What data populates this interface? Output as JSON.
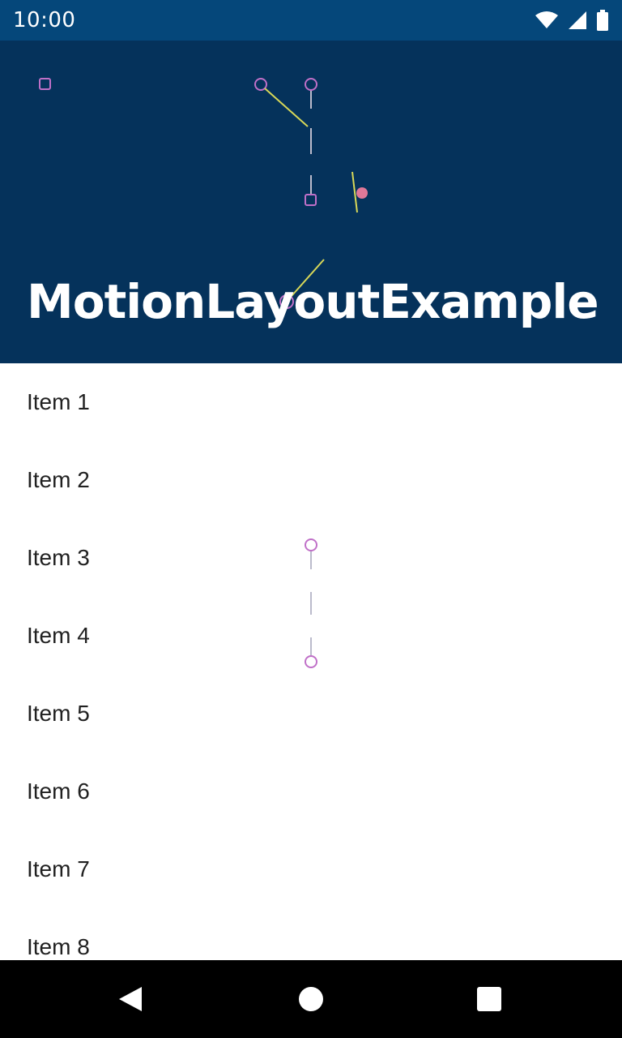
{
  "status_bar": {
    "time": "10:00",
    "icons": [
      "wifi-icon",
      "cellular-signal-icon",
      "battery-icon"
    ]
  },
  "header": {
    "title": "MotionLayoutExample"
  },
  "list": {
    "items": [
      {
        "label": "Item 1"
      },
      {
        "label": "Item 2"
      },
      {
        "label": "Item 3"
      },
      {
        "label": "Item 4"
      },
      {
        "label": "Item 5"
      },
      {
        "label": "Item 6"
      },
      {
        "label": "Item 7"
      },
      {
        "label": "Item 8"
      }
    ]
  },
  "nav_bar": {
    "buttons": [
      "back-icon",
      "home-icon",
      "recents-icon"
    ]
  },
  "colors": {
    "status_bar": "#05477a",
    "header": "#05325b",
    "text_primary": "#212121",
    "debug_path": "#d8d858",
    "debug_keyframe": "#c070c8"
  }
}
